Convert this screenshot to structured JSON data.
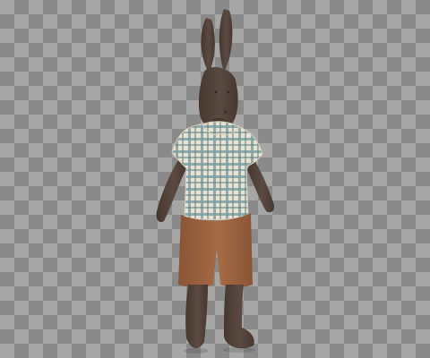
{
  "image": {
    "subject": "plush-bunny-toy",
    "background": "transparency-checkerboard"
  },
  "colors": {
    "checker_dark": "#8a8a8a",
    "checker_light": "#a6a6a6",
    "fur": "#5a4a42",
    "fur_shadow": "#46382f",
    "shirt_base": "#e9e2d2",
    "shirt_blue": "#7fa0a4",
    "shirt_teal": "#5f8583",
    "shorts": "#a66b45",
    "shorts_shadow": "#8a5535"
  }
}
